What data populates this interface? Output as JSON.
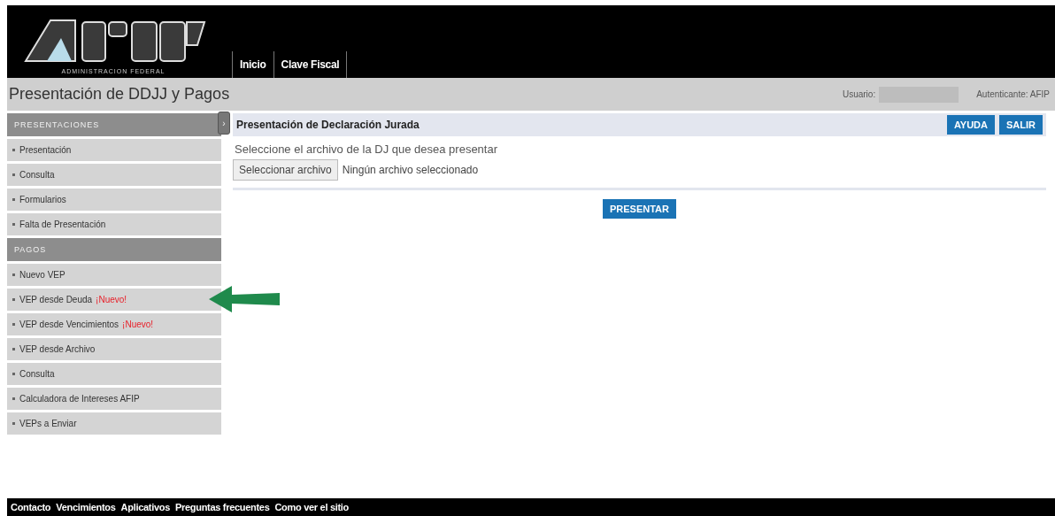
{
  "header": {
    "logo_caption": "ADMINISTRACION FEDERAL",
    "nav": [
      "Inicio",
      "Clave Fiscal"
    ]
  },
  "title_bar": {
    "title": "Presentación de DDJJ y Pagos",
    "user_label": "Usuario:",
    "auth": "Autenticante: AFIP"
  },
  "sidebar": {
    "collapse_icon": "›",
    "sections": [
      {
        "title": "PRESENTACIONES",
        "items": [
          {
            "label": "Presentación"
          },
          {
            "label": "Consulta"
          },
          {
            "label": "Formularios"
          },
          {
            "label": "Falta de Presentación"
          }
        ]
      },
      {
        "title": "PAGOS",
        "items": [
          {
            "label": "Nuevo VEP"
          },
          {
            "label": "VEP desde Deuda",
            "badge": "¡Nuevo!",
            "pointed": true
          },
          {
            "label": "VEP desde Vencimientos",
            "badge": "¡Nuevo!"
          },
          {
            "label": "VEP desde Archivo"
          },
          {
            "label": "Consulta"
          },
          {
            "label": "Calculadora de Intereses AFIP"
          },
          {
            "label": "VEPs a Enviar"
          }
        ]
      }
    ]
  },
  "panel": {
    "title": "Presentación de Declaración Jurada",
    "buttons": [
      "AYUDA",
      "SALIR"
    ],
    "instruction": "Seleccione el archivo de la DJ que desea presentar",
    "file_button": "Seleccionar archivo",
    "file_status": "Ningún archivo seleccionado",
    "submit": "PRESENTAR"
  },
  "footer": [
    "Contacto",
    "Vencimientos",
    "Aplicativos",
    "Preguntas frecuentes",
    "Como ver el sitio"
  ]
}
